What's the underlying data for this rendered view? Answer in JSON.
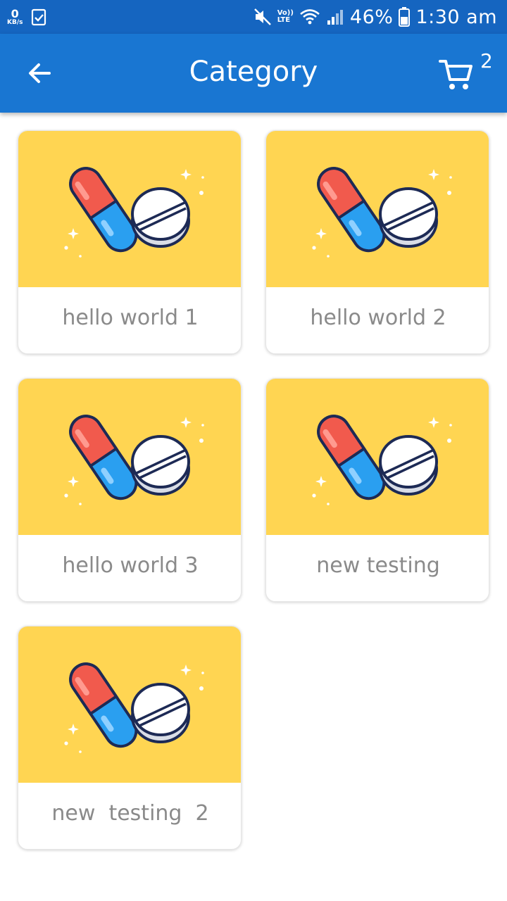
{
  "status_bar": {
    "data_rate": "0",
    "data_rate_unit": "KB/s",
    "volte_top": "Vo))",
    "volte_bottom": "LTE",
    "battery_percent": "46%",
    "time": "1:30 am"
  },
  "app_bar": {
    "title": "Category",
    "cart_count": "2"
  },
  "categories": [
    {
      "label": "hello world 1"
    },
    {
      "label": "hello world 2"
    },
    {
      "label": "hello world 3"
    },
    {
      "label": "new testing"
    },
    {
      "label": "new  testing  2"
    }
  ],
  "colors": {
    "status_bar": "#1565c0",
    "app_bar": "#1976d2",
    "card_image_bg": "#ffd552",
    "card_label_text": "#8a8a8a"
  },
  "icons": {
    "back": "arrow-left-icon",
    "cart": "shopping-cart-icon",
    "category_image": "pills-illustration"
  }
}
